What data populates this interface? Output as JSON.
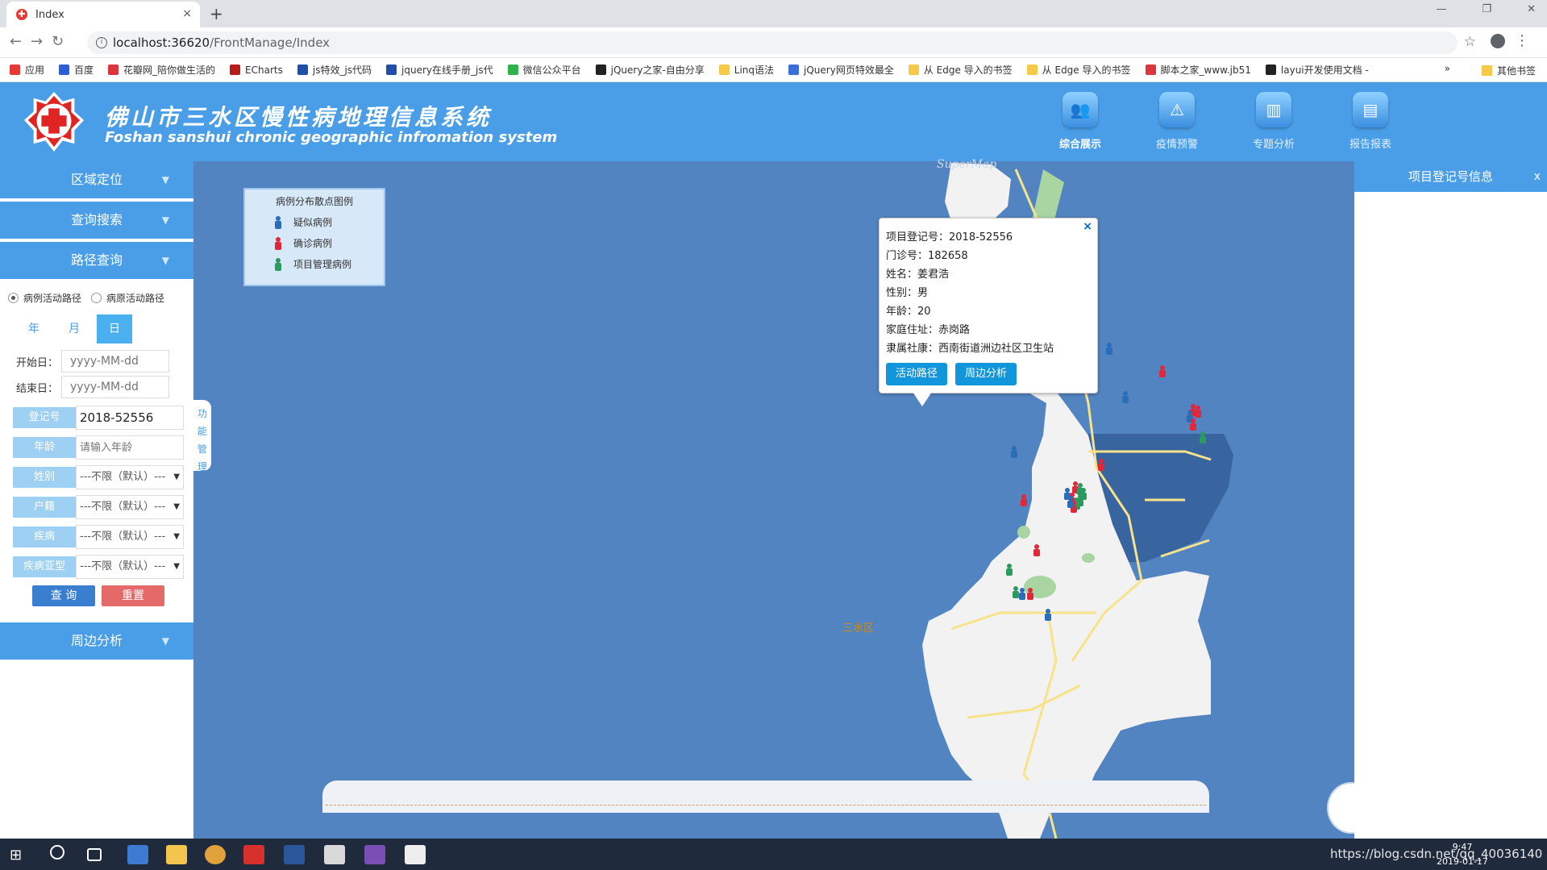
{
  "browser": {
    "tab_title": "Index",
    "tab_close": "×",
    "new_tab": "+",
    "url_host": "localhost:36620",
    "url_path": "/FrontManage/Index",
    "bookmarks": [
      {
        "label": "应用",
        "color": "#e53935"
      },
      {
        "label": "百度",
        "color": "#2b5fd9"
      },
      {
        "label": "花瓣网_陪你做生活的",
        "color": "#d9363e"
      },
      {
        "label": "ECharts",
        "color": "#b71c1c"
      },
      {
        "label": "js特效_js代码",
        "color": "#1f4fa8"
      },
      {
        "label": "jquery在线手册_js代",
        "color": "#1f4fa8"
      },
      {
        "label": "微信公众平台",
        "color": "#2fb24b"
      },
      {
        "label": "jQuery之家-自由分享",
        "color": "#222"
      },
      {
        "label": "Linq语法",
        "color": "#f6c94a"
      },
      {
        "label": "jQuery网页特效最全",
        "color": "#3a6fd6"
      },
      {
        "label": "从 Edge 导入的书签",
        "color": "#f6c94a"
      },
      {
        "label": "从 Edge 导入的书签",
        "color": "#f6c94a"
      },
      {
        "label": "脚本之家_www.jb51",
        "color": "#d9363e"
      },
      {
        "label": "layui开发使用文档 -",
        "color": "#222"
      }
    ],
    "bookmarks_more": "»",
    "other_bookmarks": "其他书签"
  },
  "header": {
    "title": "佛山市三水区慢性病地理信息系统",
    "subtitle": "Foshan sanshui chronic geographic infromation system",
    "nav": [
      {
        "label": "综合展示",
        "active": true,
        "icon": "people-icon"
      },
      {
        "label": "疫情预警",
        "active": false,
        "icon": "alarm-icon"
      },
      {
        "label": "专题分析",
        "active": false,
        "icon": "chart-icon"
      },
      {
        "label": "报告报表",
        "active": false,
        "icon": "report-icon"
      }
    ]
  },
  "sidebar": {
    "sections": [
      "区域定位",
      "查询搜索",
      "路径查询",
      "周边分析"
    ],
    "route": {
      "radio1": "病例活动路径",
      "radio2": "病原活动路径",
      "seg_year": "年",
      "seg_month": "月",
      "seg_day": "日",
      "start_label": "开始日：",
      "end_label": "结束日：",
      "date_placeholder": "yyyy-MM-dd"
    },
    "form": {
      "reg_label": "登记号",
      "reg_value": "2018-52556",
      "age_label": "年龄",
      "age_placeholder": "请输入年龄",
      "gender_label": "姓别",
      "huji_label": "户籍",
      "disease_label": "疾病",
      "subtype_label": "疾病亚型",
      "select_default": "---不限（默认）---",
      "query_btn": "查 询",
      "reset_btn": "重置"
    },
    "vtab": "功能管理"
  },
  "map": {
    "watermark": "SuperMap",
    "district_label": "三水区",
    "legend": {
      "title": "病例分布散点图例",
      "items": [
        {
          "label": "疑似病例",
          "color": "#2a6db8"
        },
        {
          "label": "确诊病例",
          "color": "#e0283a"
        },
        {
          "label": "项目管理病例",
          "color": "#2b9a5e"
        }
      ]
    },
    "popup": {
      "close": "×",
      "lines": [
        "项目登记号：2018-52556",
        "门诊号：182658",
        "姓名：姜君浩",
        "性别：男",
        "年龄：20",
        "家庭住址：赤岗路",
        "隶属社康：西南街道洲边社区卫生站"
      ],
      "btn_route": "活动路径",
      "btn_around": "周边分析"
    }
  },
  "right_panel": {
    "title": "项目登记号信息",
    "close": "x"
  },
  "taskbar": {
    "watermark": "https://blog.csdn.net/qq_40036140",
    "time": "9:47",
    "date": "2019-01-17"
  }
}
